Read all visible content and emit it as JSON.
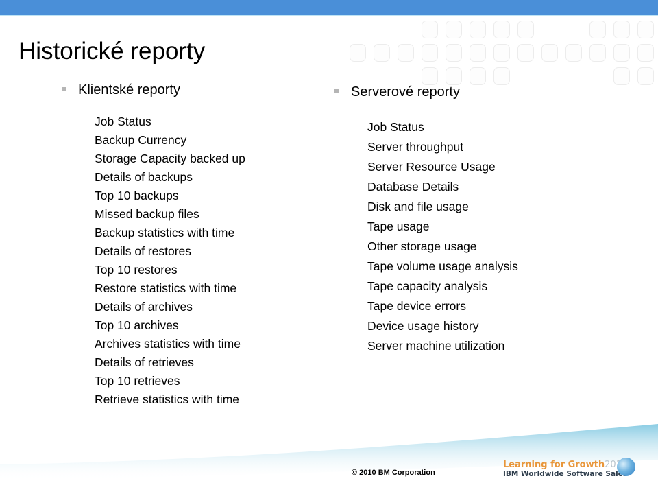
{
  "slide": {
    "title": "Historické reporty"
  },
  "client_reports": {
    "heading": "Klientské reporty",
    "items": [
      "Job Status",
      "Backup Currency",
      "Storage Capacity backed up",
      "Details of backups",
      "Top 10 backups",
      "Missed backup files",
      "Backup statistics with time",
      "Details of restores",
      "Top 10 restores",
      "Restore statistics with time",
      "Details of archives",
      "Top 10 archives",
      "Archives statistics with time",
      "Details of retrieves",
      "Top 10 retrieves",
      "Retrieve statistics with time"
    ]
  },
  "server_reports": {
    "heading": "Serverové reporty",
    "items": [
      "Job Status",
      "Server throughput",
      "Server Resource Usage",
      "Database Details",
      "Disk and file usage",
      "Tape usage",
      "Other storage usage",
      "Tape volume usage analysis",
      "Tape capacity analysis",
      "Tape device errors",
      "Device usage history",
      "Server machine utilization"
    ]
  },
  "footer": {
    "copyright": "© 2010 BM Corporation",
    "logo_line1": "Learning for Growth",
    "logo_year": "2010",
    "logo_line2": "IBM Worldwide Software Sales"
  },
  "colors": {
    "top_bar": "#4a8fd8",
    "logo_orange": "#e8963a",
    "bullet_gray": "#b5b5b5"
  }
}
